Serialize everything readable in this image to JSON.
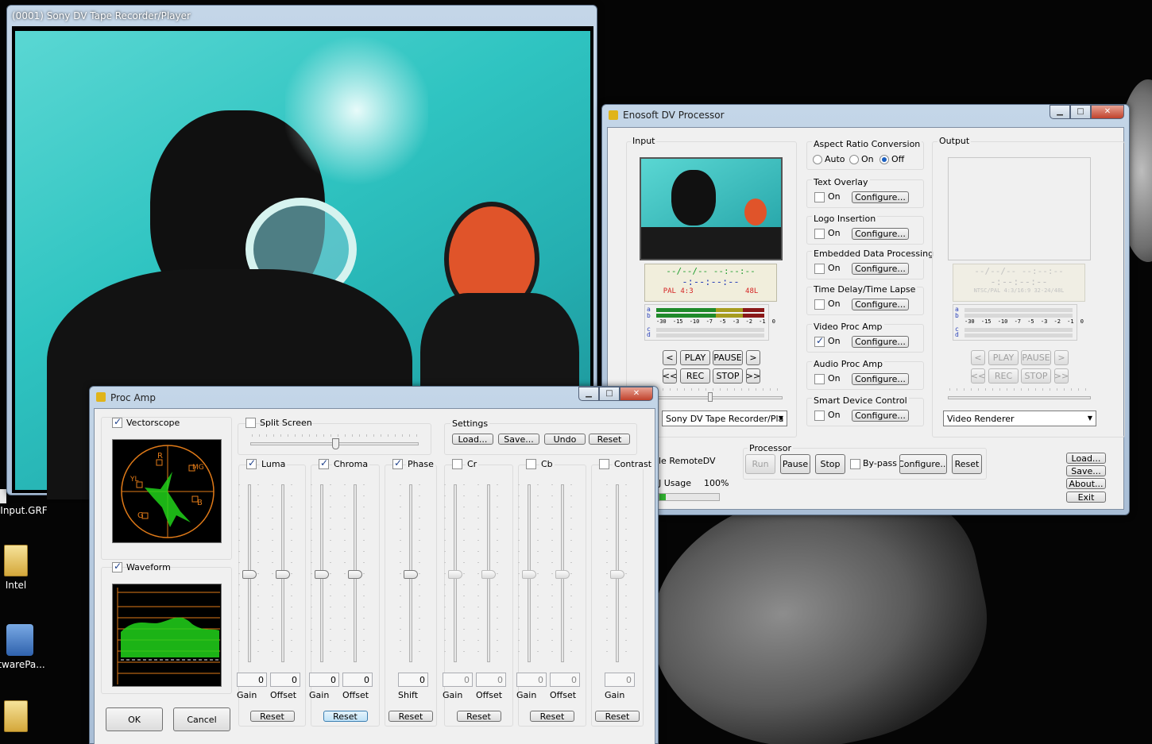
{
  "desktop": {
    "icons": [
      {
        "label": "Input.GRF"
      },
      {
        "label": "Intel"
      },
      {
        "label": "ftwarePa..."
      }
    ]
  },
  "player": {
    "title": "(0001) Sony DV Tape Recorder/Player"
  },
  "dvp": {
    "title": "Enosoft DV Processor",
    "input_label": "Input",
    "output_label": "Output",
    "input_tc_top": "--/--/-- --:--:--",
    "input_tc_mid": "-:--:--:--",
    "input_format": "PAL 4:3",
    "input_audio": "48L",
    "output_tc_top": "--/--/-- --:--:--",
    "output_tc_mid": "-:--:--:--",
    "output_format": "NTSC/PAL 4:3/16:9 32-24/48L",
    "meter_scale": "-30 -15 -10 -7 -5 -3 -2 -1 0",
    "meter_a": "a",
    "meter_b": "b",
    "meter_c": "c",
    "meter_d": "d",
    "transport": {
      "prev": "<",
      "play": "PLAY",
      "pause": "PAUSE",
      "next": ">",
      "rew": "<<",
      "rec": "REC",
      "stop": "STOP",
      "ff": ">>"
    },
    "input_device": "Sony DV Tape Recorder/Pla",
    "output_device": "Video Renderer",
    "aspect": {
      "label": "Aspect Ratio Conversion",
      "auto": "Auto",
      "on": "On",
      "off": "Off",
      "selected": "Off"
    },
    "modules": [
      {
        "label": "Text Overlay",
        "on": "On",
        "configure": "Configure...",
        "checked": false
      },
      {
        "label": "Logo Insertion",
        "on": "On",
        "configure": "Configure...",
        "checked": false
      },
      {
        "label": "Embedded Data Processing",
        "on": "On",
        "configure": "Configure...",
        "checked": false
      },
      {
        "label": "Time Delay/Time Lapse",
        "on": "On",
        "configure": "Configure...",
        "checked": false
      },
      {
        "label": "Video Proc Amp",
        "on": "On",
        "configure": "Configure...",
        "checked": true
      },
      {
        "label": "Audio Proc Amp",
        "on": "On",
        "configure": "Configure...",
        "checked": false
      },
      {
        "label": "Smart Device Control",
        "on": "On",
        "configure": "Configure...",
        "checked": false
      }
    ],
    "processor": {
      "label": "Processor",
      "run": "Run",
      "pause": "Pause",
      "stop": "Stop",
      "bypass": "By-pass",
      "configure": "Configure...",
      "reset": "Reset"
    },
    "remote_label": "le RemoteDV",
    "usage_label": "J Usage",
    "usage_value": "100%",
    "usage_fraction": 0.1,
    "side_buttons": {
      "load": "Load...",
      "save": "Save...",
      "about": "About...",
      "exit": "Exit"
    }
  },
  "procamp": {
    "title": "Proc Amp",
    "vectorscope_label": "Vectorscope",
    "vectorscope_marks": {
      "r": "R",
      "mg": "MG",
      "yl": "YL",
      "b": "B",
      "g": "G"
    },
    "waveform_label": "Waveform",
    "split_screen_label": "Split Screen",
    "settings_label": "Settings",
    "settings_buttons": {
      "load": "Load...",
      "save": "Save...",
      "undo": "Undo",
      "reset": "Reset"
    },
    "groups": [
      {
        "label": "Luma",
        "checked": true,
        "fields": [
          {
            "value": "0",
            "caption": "Gain"
          },
          {
            "value": "0",
            "caption": "Offset"
          }
        ],
        "reset": "Reset"
      },
      {
        "label": "Chroma",
        "checked": true,
        "fields": [
          {
            "value": "0",
            "caption": "Gain"
          },
          {
            "value": "0",
            "caption": "Offset"
          }
        ],
        "reset": "Reset"
      },
      {
        "label": "Phase",
        "checked": true,
        "fields": [
          {
            "value": "0",
            "caption": "Shift"
          }
        ],
        "reset": "Reset"
      },
      {
        "label": "Cr",
        "checked": false,
        "fields": [
          {
            "value": "0",
            "caption": "Gain"
          },
          {
            "value": "0",
            "caption": "Offset"
          }
        ],
        "reset": "Reset"
      },
      {
        "label": "Cb",
        "checked": false,
        "fields": [
          {
            "value": "0",
            "caption": "Gain"
          },
          {
            "value": "0",
            "caption": "Offset"
          }
        ],
        "reset": "Reset"
      },
      {
        "label": "Contrast",
        "checked": false,
        "fields": [
          {
            "value": "0",
            "caption": "Gain"
          }
        ],
        "reset": "Reset"
      }
    ],
    "ok": "OK",
    "cancel": "Cancel"
  },
  "colors": {
    "scope_orange": "#e07a18",
    "scope_green": "#21d21a",
    "water": "#35c6c4"
  }
}
